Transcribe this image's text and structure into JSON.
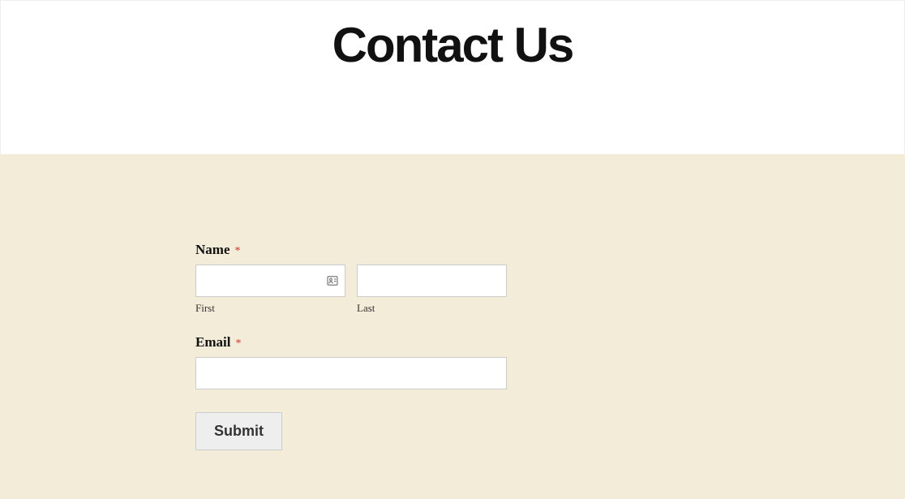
{
  "header": {
    "title": "Contact Us"
  },
  "form": {
    "name": {
      "label": "Name",
      "required_marker": "*",
      "first": {
        "value": "",
        "sublabel": "First"
      },
      "last": {
        "value": "",
        "sublabel": "Last"
      }
    },
    "email": {
      "label": "Email",
      "required_marker": "*",
      "value": ""
    },
    "submit_label": "Submit"
  }
}
